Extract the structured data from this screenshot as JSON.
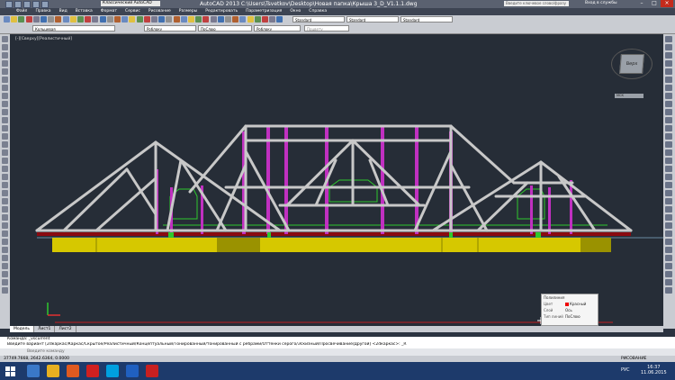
{
  "app": {
    "title": "AutoCAD 2013    C:\\Users\\Tsvetkov\\Desktop\\Новая папка\\Крыша 3_D_V1.1.1.dwg",
    "workspace": "Классический AutoCAD",
    "search_placeholder": "Введите ключевое слово/фразу",
    "services_label": "Вход в службы"
  },
  "menu": [
    "Файл",
    "Правка",
    "Вид",
    "Вставка",
    "Формат",
    "Сервис",
    "Рисование",
    "Размеры",
    "Редактировать",
    "Параметризация",
    "Окно",
    "Справка"
  ],
  "toolbar": {
    "layer": "Кольцевая",
    "color": "Poблоку",
    "linetype": "ПоСлою",
    "lineweight": "Poблоку",
    "plotstyle": "Поцвету",
    "textstyle": "Standard",
    "dimstyle": "Standard",
    "tablestyle": "Standard"
  },
  "viewport": {
    "label": "[-][Сверху][Реалистичный]",
    "viewcube": "Верх",
    "wcs": "МСК"
  },
  "properties_panel": {
    "title": "Полилиния",
    "rows": [
      {
        "label": "Цвет",
        "value": "Красный"
      },
      {
        "label": "Слой",
        "value": "Ось"
      },
      {
        "label": "Тип линий",
        "value": "ПоСлою"
      }
    ]
  },
  "tabs": [
    "Модель",
    "Лист1",
    "Лист2"
  ],
  "command": {
    "line1": "Команда: _vscurrent",
    "line2": "Введите вариант [2dкаркас/Каркас/Скрытое/Реалистичный/Концептуальный/Тонированный/тонированный с ребрами/Оттенки серого/Эскизный/Просвечивание/Другой] <2dкаркас>: _R",
    "input_placeholder": "Введите команду"
  },
  "status": {
    "coords": "37749.7668, 2642.6364, 0.0000",
    "scale": "РИСОВАНИЕ"
  },
  "taskbar": {
    "lang": "РУС",
    "time": "16:37",
    "date": "11.06.2015"
  },
  "colors": {
    "frame": "#c8c8c8",
    "post": "#c030c0",
    "wallplate": "#d6c800",
    "sill": "#8a0a10",
    "accent_green": "#2ec82e"
  }
}
